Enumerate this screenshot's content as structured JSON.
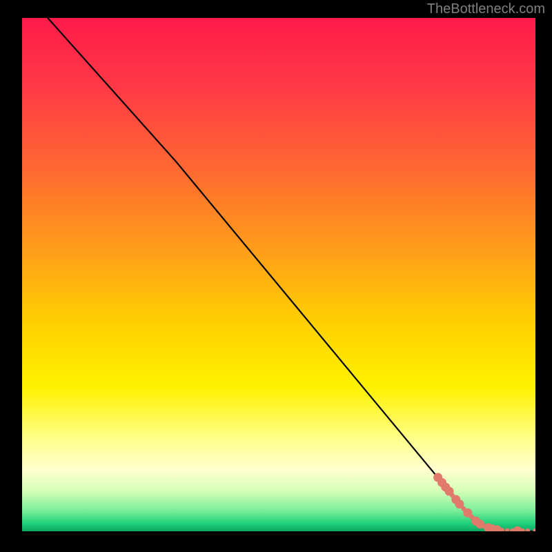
{
  "watermark": "TheBottleneck.com",
  "chart_data": {
    "type": "line",
    "title": "",
    "xlabel": "",
    "ylabel": "",
    "xlim": [
      0,
      100
    ],
    "ylim": [
      0,
      100
    ],
    "background_gradient": {
      "stops": [
        {
          "offset": 0.0,
          "color": "#ff1a4a"
        },
        {
          "offset": 0.15,
          "color": "#ff3d45"
        },
        {
          "offset": 0.3,
          "color": "#ff6a30"
        },
        {
          "offset": 0.45,
          "color": "#ff9d1a"
        },
        {
          "offset": 0.6,
          "color": "#ffd200"
        },
        {
          "offset": 0.72,
          "color": "#fff200"
        },
        {
          "offset": 0.82,
          "color": "#ffff8a"
        },
        {
          "offset": 0.88,
          "color": "#ffffd0"
        },
        {
          "offset": 0.92,
          "color": "#d8ffb8"
        },
        {
          "offset": 0.96,
          "color": "#7aee9a"
        },
        {
          "offset": 0.985,
          "color": "#1fcf7a"
        },
        {
          "offset": 1.0,
          "color": "#0ea862"
        }
      ]
    },
    "series": [
      {
        "name": "curve",
        "type": "line",
        "color": "#000000",
        "stroke_width": 2.2,
        "x": [
          5,
          30,
          88,
          94,
          100
        ],
        "y": [
          100,
          72,
          2,
          0,
          0
        ]
      },
      {
        "name": "points",
        "type": "scatter",
        "color": "#e07a6a",
        "radius_small": 3.5,
        "radius_large": 6.5,
        "points": [
          {
            "x": 81.0,
            "y": 10.5,
            "r": "large"
          },
          {
            "x": 81.8,
            "y": 9.5,
            "r": "large"
          },
          {
            "x": 82.5,
            "y": 8.6,
            "r": "large"
          },
          {
            "x": 83.2,
            "y": 7.8,
            "r": "large"
          },
          {
            "x": 83.8,
            "y": 7.0,
            "r": "small"
          },
          {
            "x": 84.5,
            "y": 6.2,
            "r": "large"
          },
          {
            "x": 85.2,
            "y": 5.3,
            "r": "large"
          },
          {
            "x": 86.0,
            "y": 4.4,
            "r": "small"
          },
          {
            "x": 86.8,
            "y": 3.6,
            "r": "large"
          },
          {
            "x": 87.6,
            "y": 2.8,
            "r": "small"
          },
          {
            "x": 88.4,
            "y": 2.0,
            "r": "large"
          },
          {
            "x": 89.2,
            "y": 1.4,
            "r": "large"
          },
          {
            "x": 90.0,
            "y": 1.0,
            "r": "small"
          },
          {
            "x": 90.8,
            "y": 0.7,
            "r": "large"
          },
          {
            "x": 91.5,
            "y": 0.5,
            "r": "large"
          },
          {
            "x": 92.5,
            "y": 0.3,
            "r": "large"
          },
          {
            "x": 93.5,
            "y": 0.2,
            "r": "small"
          },
          {
            "x": 94.5,
            "y": 0.15,
            "r": "small"
          },
          {
            "x": 95.5,
            "y": 0.1,
            "r": "small"
          },
          {
            "x": 96.5,
            "y": 0.1,
            "r": "large"
          },
          {
            "x": 97.5,
            "y": 0.1,
            "r": "small"
          },
          {
            "x": 98.5,
            "y": 0.1,
            "r": "small"
          },
          {
            "x": 100.0,
            "y": 0.1,
            "r": "small"
          }
        ]
      }
    ]
  }
}
